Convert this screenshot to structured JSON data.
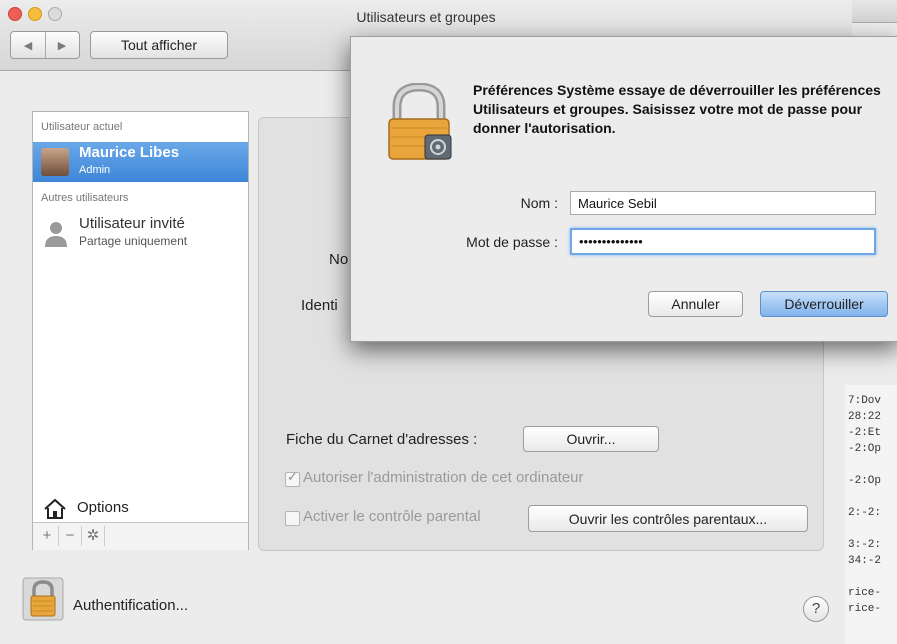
{
  "window": {
    "title": "Utilisateurs et groupes",
    "show_all": "Tout afficher"
  },
  "sidebar": {
    "current_heading": "Utilisateur actuel",
    "current_user": {
      "name": "Maurice Libes",
      "role": "Admin"
    },
    "others_heading": "Autres utilisateurs",
    "guest": {
      "name": "Utilisateur invité",
      "subtitle": "Partage uniquement"
    },
    "options_label": "Options"
  },
  "panel": {
    "name_partial": "No",
    "identity_partial": "Identi",
    "address_card_label": "Fiche du Carnet d'adresses :",
    "open_button": "Ouvrir...",
    "allow_admin_label": "Autoriser l'administration de cet ordinateur",
    "allow_admin_checked": true,
    "parental_label": "Activer le contrôle parental",
    "parental_checked": false,
    "open_parental_button": "Ouvrir les contrôles parentaux..."
  },
  "bottom": {
    "auth_label": "Authentification...",
    "help": "?"
  },
  "terminal": {
    "lines": [
      "7:Dov",
      "28:22",
      "-2:Et",
      "-2:Op",
      "",
      "-2:Op",
      "",
      "2:-2:",
      "",
      "3:-2:",
      "34:-2",
      "",
      "rice-",
      "rice-"
    ]
  },
  "dialog": {
    "message": "Préférences Système essaye de déverrouiller les préférences Utilisateurs et groupes. Saisissez votre mot de passe pour donner l'autorisation.",
    "name_label": "Nom :",
    "name_value": "Maurice Sebil",
    "password_label": "Mot de passe :",
    "password_value": "••••••••••••••",
    "cancel_button": "Annuler",
    "unlock_button": "Déverrouiller"
  },
  "colors": {
    "selection": "#3d86d8",
    "default_button": "#7fb3ec"
  }
}
